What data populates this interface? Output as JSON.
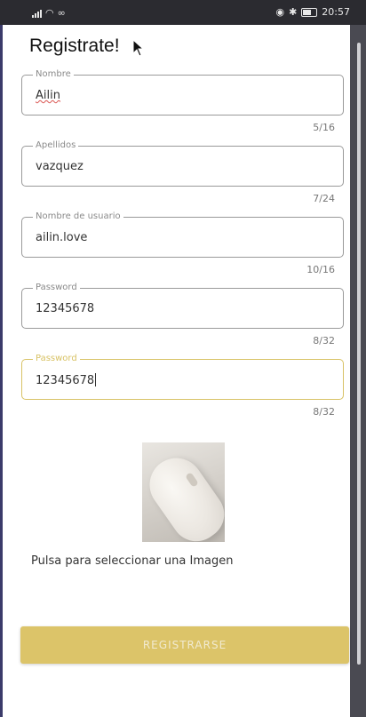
{
  "status_bar": {
    "time": "20:57",
    "icons": [
      "signal-icon",
      "wifi-icon",
      "voicemail-icon",
      "eye-icon",
      "bluetooth-icon",
      "battery-icon"
    ]
  },
  "page": {
    "title": "Registrate!"
  },
  "form": {
    "fields": [
      {
        "label": "Nombre",
        "value": "Ailin",
        "counter": "5/16"
      },
      {
        "label": "Apellidos",
        "value": "vazquez",
        "counter": "7/24"
      },
      {
        "label": "Nombre de usuario",
        "value": "ailin.love",
        "counter": "10/16"
      },
      {
        "label": "Password",
        "value": "12345678",
        "counter": "8/32"
      },
      {
        "label": "Password",
        "value": "12345678",
        "counter": "8/32"
      }
    ],
    "image_picker_label": "Pulsa para seleccionar una Imagen",
    "submit_label": "REGISTRARSE"
  },
  "colors": {
    "accent": "#dcc469",
    "focused_outline": "#d8c265",
    "text": "#333333"
  }
}
